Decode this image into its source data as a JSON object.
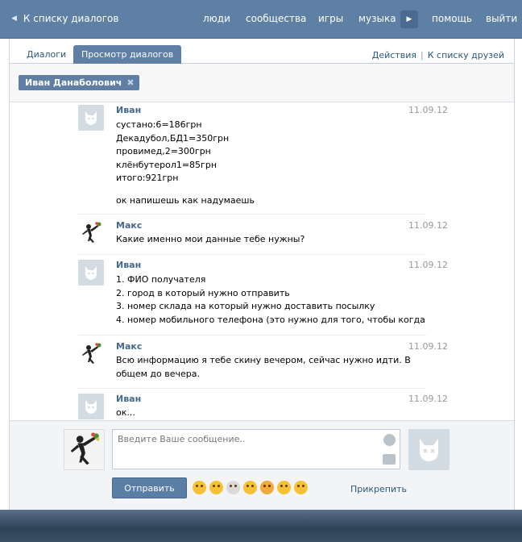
{
  "topbar": {
    "back_label": "К списку диалогов",
    "nav": [
      "люди",
      "сообщества",
      "игры",
      "музыка",
      "помощь",
      "выйти"
    ]
  },
  "tabs": {
    "dialogs": "Диалоги",
    "view": "Просмотр диалогов",
    "actions": "Действия",
    "separator": "|",
    "friends": "К списку друзей"
  },
  "recipient": {
    "name": "Иван Данаболович",
    "remove": "✖"
  },
  "messages": [
    {
      "author": "Иван",
      "date": "11.09.12",
      "lines": [
        "сустано:6=186грн",
        "Декадубол,БД1=350грн",
        "провимед,2=300грн",
        "клёнбутерол1=85грн",
        "итого:921грн"
      ],
      "extra": "ок напишешь как надумаешь"
    },
    {
      "author": "Макс",
      "date": "11.09.12",
      "lines": [
        "Какие именно мои данные тебе нужны?"
      ]
    },
    {
      "author": "Иван",
      "date": "11.09.12",
      "lines": [
        "1. ФИО получателя",
        "2. город в который нужно отправить",
        "3. номер склада на который нужно доставить посылку",
        "4. номер мобильного телефона (это нужно для того, чтобы когда"
      ]
    },
    {
      "author": "Макс",
      "date": "11.09.12",
      "lines": [
        "Всю информацию я тебе скину вечером, сейчас нужно идти. В",
        "общем до вечера."
      ]
    },
    {
      "author": "Иван",
      "date": "11.09.12",
      "lines": [
        "ок..."
      ]
    }
  ],
  "composer": {
    "placeholder": "Введите Ваше сообщение..",
    "send_label": "Отправить",
    "attach_label": "Прикрепить"
  }
}
